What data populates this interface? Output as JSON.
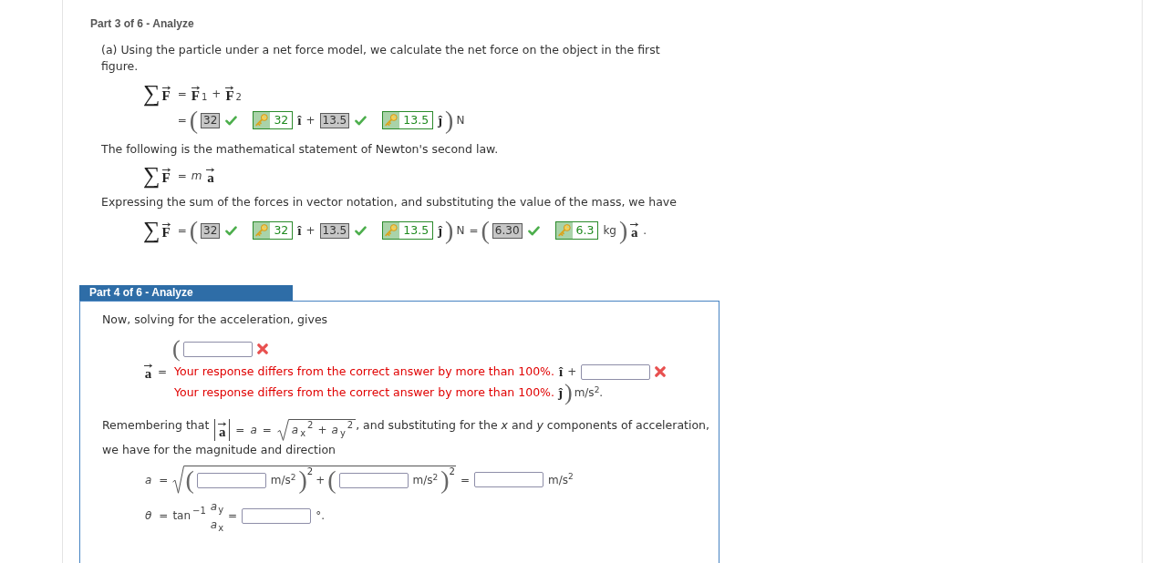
{
  "part3": {
    "header": "Part 3 of 6 - Analyze",
    "intro": "(a) Using the particle under a net force model, we calculate the net force on the object in the first figure.",
    "net_force_equation": [
      {
        "lhs": [
          {
            "kind": "sum",
            "text": "∑"
          },
          {
            "kind": "vector",
            "text": "F"
          }
        ],
        "rhs": [
          {
            "kind": "op",
            "text": "="
          },
          {
            "kind": "vector",
            "text": "F"
          },
          {
            "kind": "sub",
            "text": "1"
          },
          {
            "kind": "op",
            "text": "+"
          },
          {
            "kind": "vector",
            "text": "F"
          },
          {
            "kind": "sub",
            "text": "2"
          }
        ]
      },
      {
        "rhs": [
          {
            "kind": "op",
            "text": "="
          },
          {
            "kind": "paren",
            "text": "("
          },
          {
            "kind": "submitted",
            "value": "32",
            "correct": true
          },
          {
            "kind": "key",
            "value": "32"
          },
          {
            "kind": "unit_vector",
            "text": "î"
          },
          {
            "kind": "op",
            "text": "+"
          },
          {
            "kind": "submitted",
            "value": "13.5",
            "correct": true
          },
          {
            "kind": "key",
            "value": "13.5"
          },
          {
            "kind": "unit_vector",
            "text": "ĵ"
          },
          {
            "kind": "paren",
            "text": ")"
          },
          {
            "kind": "unit",
            "text": "N"
          }
        ]
      }
    ],
    "newton_text": "The following is the mathematical statement of Newton's second law.",
    "newton_equation": [
      {
        "lhs": [
          {
            "kind": "sum",
            "text": "∑"
          },
          {
            "kind": "vector",
            "text": "F"
          }
        ],
        "rhs": [
          {
            "kind": "op",
            "text": "="
          },
          {
            "kind": "variable",
            "text": "m"
          },
          {
            "kind": "vector",
            "text": "a"
          }
        ]
      }
    ],
    "substitution_text": "Expressing the sum of the forces in vector notation, and substituting the value of the mass, we have",
    "substitution_equation": [
      {
        "lhs": [
          {
            "kind": "sum",
            "text": "∑"
          },
          {
            "kind": "vector",
            "text": "F"
          }
        ],
        "rhs": [
          {
            "kind": "op",
            "text": "="
          },
          {
            "kind": "paren",
            "text": "("
          },
          {
            "kind": "submitted",
            "value": "32",
            "correct": true
          },
          {
            "kind": "key",
            "value": "32"
          },
          {
            "kind": "unit_vector",
            "text": "î"
          },
          {
            "kind": "op",
            "text": "+"
          },
          {
            "kind": "submitted",
            "value": "13.5",
            "correct": true
          },
          {
            "kind": "key",
            "value": "13.5"
          },
          {
            "kind": "unit_vector",
            "text": "ĵ"
          },
          {
            "kind": "paren",
            "text": ")"
          },
          {
            "kind": "unit",
            "text": "N"
          },
          {
            "kind": "op",
            "text": "="
          },
          {
            "kind": "paren",
            "text": "("
          },
          {
            "kind": "submitted",
            "value": "6.30",
            "correct": true
          },
          {
            "kind": "key",
            "value": "6.3"
          },
          {
            "kind": "unit",
            "text": "kg"
          },
          {
            "kind": "paren",
            "text": ")"
          },
          {
            "kind": "vector",
            "text": "a"
          },
          {
            "kind": "op",
            "text": "."
          }
        ]
      }
    ]
  },
  "part4": {
    "header": "Part 4 of 6 - Analyze",
    "intro": "Now, solving for the acceleration, gives",
    "acceleration_equation": {
      "lhs": [
        {
          "kind": "vector",
          "text": "a"
        },
        {
          "kind": "op",
          "text": "="
        }
      ],
      "open_paren": "(",
      "x_field": {
        "correct": false,
        "feedback": "Your response differs from the correct answer by more than 100%."
      },
      "i_hat": "î",
      "plus": "+",
      "y_field": {
        "correct": false,
        "feedback": "Your response differs from the correct answer by more than 100%."
      },
      "j_hat": "ĵ",
      "close_paren": ")",
      "unit": "m/s$^{2}$."
    },
    "magnitude_text": {
      "before": "Remembering that",
      "math": [
        {
          "kind": "abs",
          "children": [
            {
              "kind": "vector",
              "text": "a"
            }
          ]
        },
        {
          "kind": "op",
          "text": "="
        },
        {
          "kind": "variable",
          "text": "a"
        },
        {
          "kind": "op",
          "text": "="
        },
        {
          "kind": "sqrt",
          "children": [
            {
              "kind": "variable",
              "text": "a"
            },
            {
              "kind": "sub",
              "text": "x"
            },
            {
              "kind": "sup",
              "text": "2"
            },
            {
              "kind": "op",
              "text": "+"
            },
            {
              "kind": "variable",
              "text": "a"
            },
            {
              "kind": "sub",
              "text": "y"
            },
            {
              "kind": "sup",
              "text": "2"
            }
          ]
        }
      ],
      "after": ", and substituting for the *x* and *y* components of acceleration,"
    },
    "magnitude_text_end": "we have for the magnitude and direction",
    "magnitude_equation": [
      {
        "lhs": [
          {
            "kind": "variable",
            "text": "a"
          }
        ],
        "rhs": [
          {
            "kind": "op",
            "text": "="
          },
          {
            "kind": "sqrt",
            "children": [
              {
                "kind": "paren",
                "text": "("
              },
              {
                "kind": "field"
              },
              {
                "kind": "unit",
                "text": "m/s$^{2}$"
              },
              {
                "kind": "paren",
                "text": ")",
                "sup": "2"
              },
              {
                "kind": "op",
                "text": "+"
              },
              {
                "kind": "paren",
                "text": "("
              },
              {
                "kind": "field"
              },
              {
                "kind": "unit",
                "text": "m/s$^{2}$"
              },
              {
                "kind": "paren",
                "text": ")",
                "sup": "2"
              }
            ]
          },
          {
            "kind": "op",
            "text": "="
          },
          {
            "kind": "field"
          },
          {
            "kind": "unit",
            "text": "m/s$^{2}$"
          }
        ]
      }
    ],
    "angle_equation": [
      {
        "lhs": [
          {
            "kind": "variable",
            "text": "θ"
          }
        ],
        "rhs": [
          {
            "kind": "op",
            "text": "="
          },
          {
            "kind": "function",
            "text": "tan"
          },
          {
            "kind": "sup",
            "text": "−1"
          },
          {
            "kind": "fraction",
            "numerator": [
              {
                "kind": "variable",
                "text": "a"
              },
              {
                "kind": "sub",
                "text": "y"
              }
            ],
            "denominator": [
              {
                "kind": "variable",
                "text": "a"
              },
              {
                "kind": "sub",
                "text": "x"
              }
            ]
          },
          {
            "kind": "op",
            "text": "="
          },
          {
            "kind": "field"
          },
          {
            "kind": "unit",
            "text": "°."
          }
        ]
      }
    ]
  }
}
